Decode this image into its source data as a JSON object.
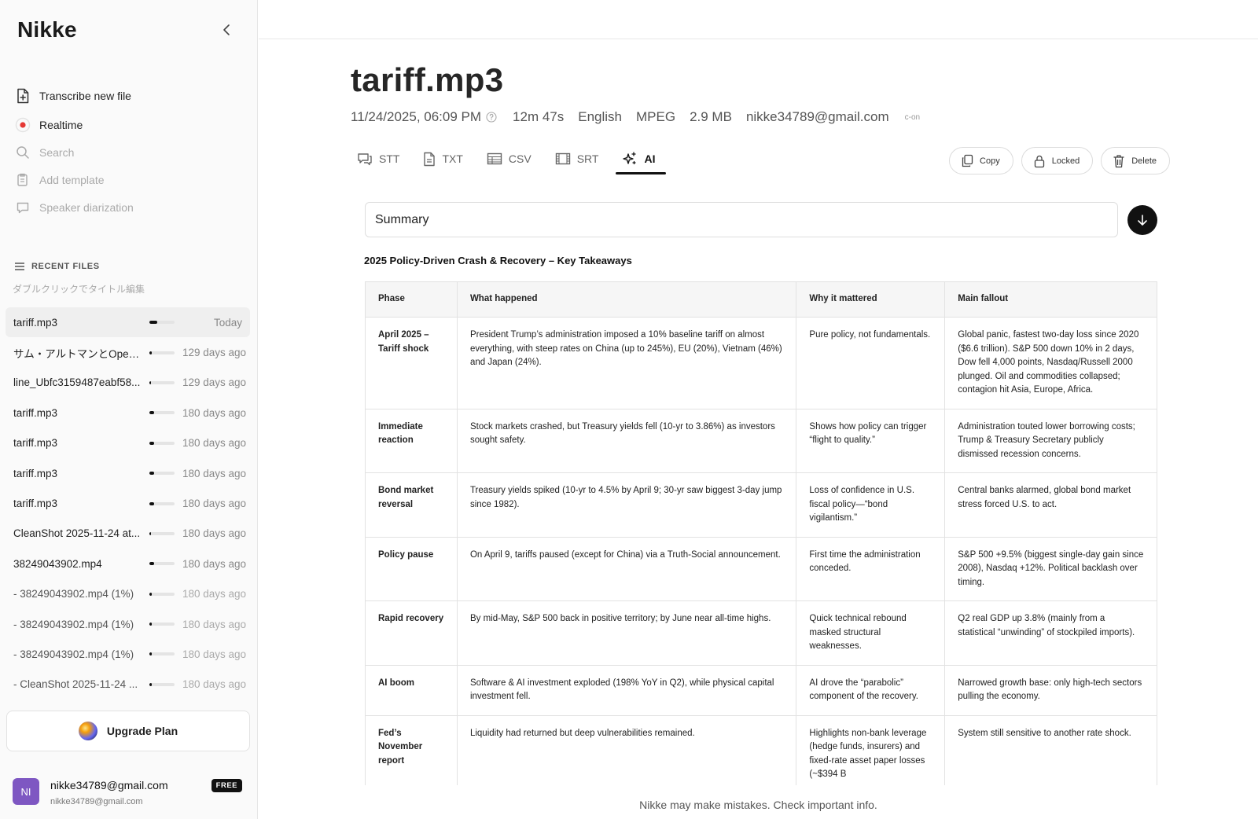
{
  "app": {
    "brand": "Nikke"
  },
  "sidebar": {
    "nav": [
      {
        "label": "Transcribe new file",
        "icon": "file-plus-icon"
      },
      {
        "label": "Realtime",
        "icon": "record-icon"
      },
      {
        "label": "Search",
        "icon": "search-icon"
      },
      {
        "label": "Add template",
        "icon": "template-icon"
      },
      {
        "label": "Speaker diarization",
        "icon": "speech-bubble-icon"
      }
    ],
    "recent_header": "RECENT FILES",
    "recent_hint": "ダブルクリックでタイトル編集",
    "files": [
      {
        "name": "tariff.mp3",
        "date": "Today",
        "progress": 0.3
      },
      {
        "name": "サム・アルトマンとOpen...",
        "date": "129 days ago",
        "progress": 0.08
      },
      {
        "name": "line_Ubfc3159487eabf58...",
        "date": "129 days ago",
        "progress": 0.05
      },
      {
        "name": "tariff.mp3",
        "date": "180 days ago",
        "progress": 0.2
      },
      {
        "name": "tariff.mp3",
        "date": "180 days ago",
        "progress": 0.2
      },
      {
        "name": "tariff.mp3",
        "date": "180 days ago",
        "progress": 0.2
      },
      {
        "name": "tariff.mp3",
        "date": "180 days ago",
        "progress": 0.2
      },
      {
        "name": "CleanShot 2025-11-24 at...",
        "date": "180 days ago",
        "progress": 0.05
      },
      {
        "name": "38249043902.mp4",
        "date": "180 days ago",
        "progress": 0.2
      },
      {
        "name": "- 38249043902.mp4 (1%)",
        "date": "180 days ago",
        "progress": 0.1
      },
      {
        "name": "- 38249043902.mp4 (1%)",
        "date": "180 days ago",
        "progress": 0.1
      },
      {
        "name": "- 38249043902.mp4 (1%)",
        "date": "180 days ago",
        "progress": 0.1
      },
      {
        "name": "- CleanShot 2025-11-24 ...",
        "date": "180 days ago",
        "progress": 0.1
      }
    ],
    "upgrade_label": "Upgrade Plan",
    "account": {
      "initials": "NI",
      "email": "nikke34789@gmail.com",
      "sub": "nikke34789@gmail.com",
      "plan_badge": "FREE"
    }
  },
  "file": {
    "title": "tariff.mp3",
    "datetime": "11/24/2025, 06:09 PM",
    "duration": "12m 47s",
    "language": "English",
    "format": "MPEG",
    "size": "2.9 MB",
    "owner": "nikke34789@gmail.com",
    "tag": "c-on"
  },
  "tabs": [
    {
      "label": "STT",
      "icon": "speech-icon"
    },
    {
      "label": "TXT",
      "icon": "document-icon"
    },
    {
      "label": "CSV",
      "icon": "table-icon"
    },
    {
      "label": "SRT",
      "icon": "film-icon"
    },
    {
      "label": "AI",
      "icon": "sparkles-icon",
      "active": true
    }
  ],
  "actions": {
    "copy": "Copy",
    "locked": "Locked",
    "delete": "Delete"
  },
  "prompt": {
    "value": "Summary"
  },
  "summary": {
    "title": "2025 Policy-Driven Crash & Recovery – Key Takeaways",
    "headers": [
      "Phase",
      "What happened",
      "Why it mattered",
      "Main fallout"
    ],
    "rows": [
      [
        "April 2025 – Tariff shock",
        "President Trump’s administration imposed a 10% baseline tariff on almost everything, with steep rates on China (up to 245%), EU (20%), Vietnam (46%) and Japan (24%).",
        "Pure policy, not fundamentals.",
        "Global panic, fastest two-day loss since 2020 ($6.6 trillion). S&P 500 down 10% in 2 days, Dow fell 4,000 points, Nasdaq/Russell 2000 plunged. Oil and commodities collapsed; contagion hit Asia, Europe, Africa."
      ],
      [
        "Immediate reaction",
        "Stock markets crashed, but Treasury yields fell (10-yr to 3.86%) as investors sought safety.",
        "Shows how policy can trigger “flight to quality.”",
        "Administration touted lower borrowing costs; Trump & Treasury Secretary publicly dismissed recession concerns."
      ],
      [
        "Bond market reversal",
        "Treasury yields spiked (10-yr to 4.5% by April 9; 30-yr saw biggest 3-day jump since 1982).",
        "Loss of confidence in U.S. fiscal policy—“bond vigilantism.”",
        "Central banks alarmed, global bond market stress forced U.S. to act."
      ],
      [
        "Policy pause",
        "On April 9, tariffs paused (except for China) via a Truth-Social announcement.",
        "First time the administration conceded.",
        "S&P 500 +9.5% (biggest single-day gain since 2008), Nasdaq +12%. Political backlash over timing."
      ],
      [
        "Rapid recovery",
        "By mid-May, S&P 500 back in positive territory; by June near all-time highs.",
        "Quick technical rebound masked structural weaknesses.",
        "Q2 real GDP up 3.8% (mainly from a statistical “unwinding” of stockpiled imports)."
      ],
      [
        "AI boom",
        "Software & AI investment exploded (198% YoY in Q2), while physical capital investment fell.",
        "AI drove the “parabolic” component of the recovery.",
        "Narrowed growth base: only high-tech sectors pulling the economy."
      ],
      [
        "Fed’s November report",
        "Liquidity had returned but deep vulnerabilities remained.",
        "Highlights non-bank leverage (hedge funds, insurers) and fixed-rate asset paper losses (~$394 B",
        "System still sensitive to another rate shock."
      ]
    ]
  },
  "disclaimer": "Nikke may make mistakes. Check important info."
}
